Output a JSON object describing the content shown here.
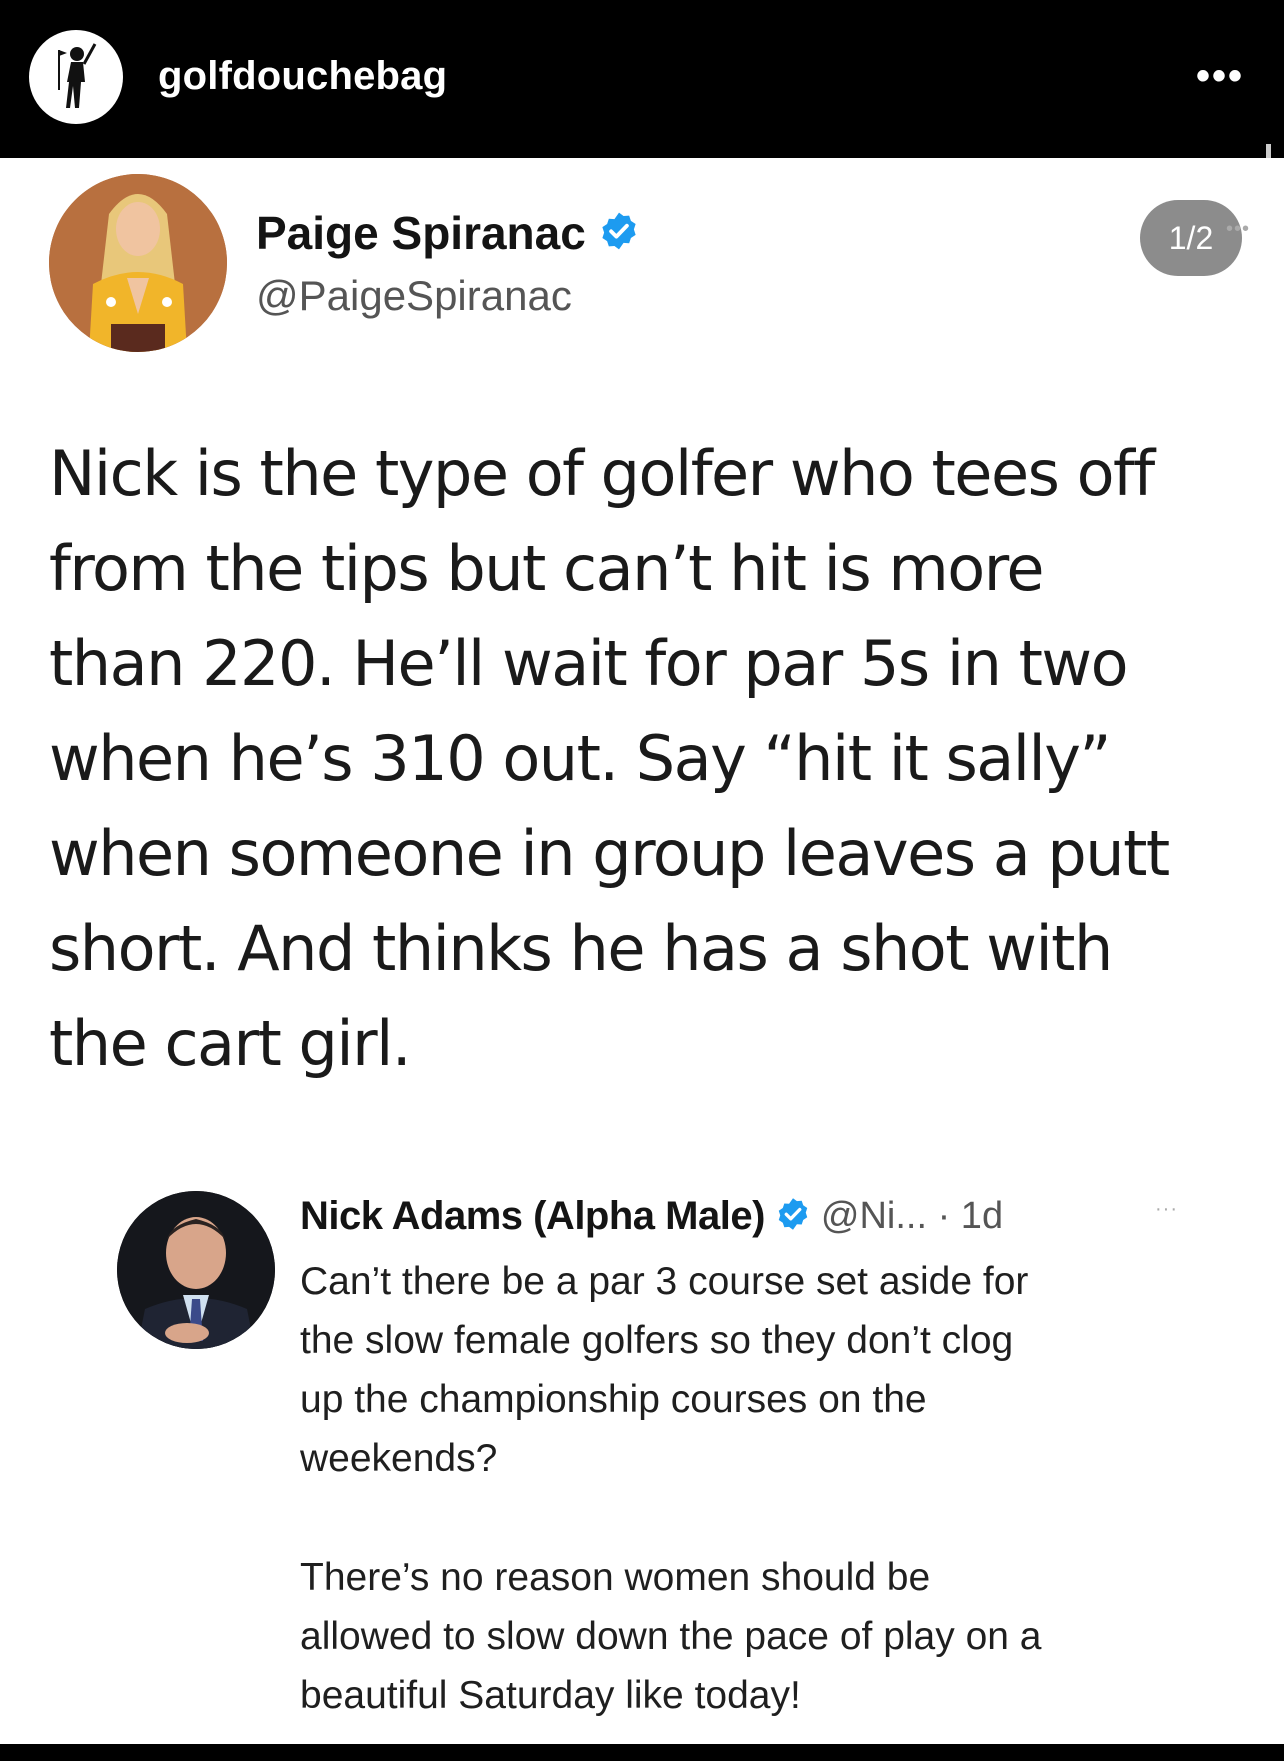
{
  "instagram": {
    "username": "golfdouchebag",
    "more_icon": "more-horizontal-icon",
    "more_label": "•••",
    "media_counter": "1/2"
  },
  "tweet": {
    "author_name": "Paige Spiranac",
    "author_handle": "@PaigeSpiranac",
    "verified": true,
    "verified_color": "#1d9bf0",
    "text": "Nick is the type of golfer who tees off\nfrom the tips but can’t hit is more\nthan 220. He’ll wait for par 5s in two\nwhen he’s 310 out. Say “hit it sally”\nwhen someone in group leaves a putt\nshort. And thinks he has a shot with\nthe cart girl."
  },
  "quoted_tweet": {
    "author_name": "Nick Adams (Alpha Male)",
    "author_handle": "@Ni... · 1d",
    "verified": true,
    "more_icon": "more-horizontal-icon",
    "more_label": "···",
    "text_paragraph_1": "Can’t there be a par 3 course set aside for\nthe slow female golfers so they don’t clog\nup the championship courses on the\nweekends?",
    "text_paragraph_2": "There’s no reason women should be\nallowed to slow down the pace of play on a\nbeautiful Saturday like today!"
  }
}
